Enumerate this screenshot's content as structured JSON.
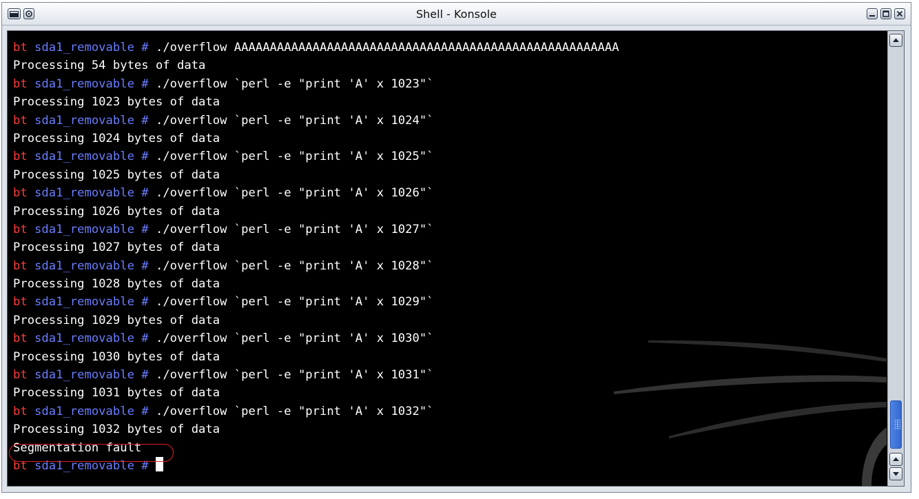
{
  "window": {
    "title": "Shell - Konsole"
  },
  "terminal": {
    "prompt": {
      "user": "bt",
      "dir": "sda1_removable",
      "symbol": "#"
    },
    "lines": [
      {
        "type": "cmd",
        "text": "./overflow AAAAAAAAAAAAAAAAAAAAAAAAAAAAAAAAAAAAAAAAAAAAAAAAAAAAAA"
      },
      {
        "type": "out",
        "text": "Processing 54 bytes of data"
      },
      {
        "type": "cmd",
        "text": "./overflow `perl -e \"print 'A' x 1023\"`"
      },
      {
        "type": "out",
        "text": "Processing 1023 bytes of data"
      },
      {
        "type": "cmd",
        "text": "./overflow `perl -e \"print 'A' x 1024\"`"
      },
      {
        "type": "out",
        "text": "Processing 1024 bytes of data"
      },
      {
        "type": "cmd",
        "text": "./overflow `perl -e \"print 'A' x 1025\"`"
      },
      {
        "type": "out",
        "text": "Processing 1025 bytes of data"
      },
      {
        "type": "cmd",
        "text": "./overflow `perl -e \"print 'A' x 1026\"`"
      },
      {
        "type": "out",
        "text": "Processing 1026 bytes of data"
      },
      {
        "type": "cmd",
        "text": "./overflow `perl -e \"print 'A' x 1027\"`"
      },
      {
        "type": "out",
        "text": "Processing 1027 bytes of data"
      },
      {
        "type": "cmd",
        "text": "./overflow `perl -e \"print 'A' x 1028\"`"
      },
      {
        "type": "out",
        "text": "Processing 1028 bytes of data"
      },
      {
        "type": "cmd",
        "text": "./overflow `perl -e \"print 'A' x 1029\"`"
      },
      {
        "type": "out",
        "text": "Processing 1029 bytes of data"
      },
      {
        "type": "cmd",
        "text": "./overflow `perl -e \"print 'A' x 1030\"`"
      },
      {
        "type": "out",
        "text": "Processing 1030 bytes of data"
      },
      {
        "type": "cmd",
        "text": "./overflow `perl -e \"print 'A' x 1031\"`"
      },
      {
        "type": "out",
        "text": "Processing 1031 bytes of data"
      },
      {
        "type": "cmd",
        "text": "./overflow `perl -e \"print 'A' x 1032\"`"
      },
      {
        "type": "out",
        "text": "Processing 1032 bytes of data"
      },
      {
        "type": "out",
        "text": "Segmentation fault"
      },
      {
        "type": "cmd",
        "text": ""
      }
    ],
    "highlighted_output": "Segmentation fault"
  },
  "colors": {
    "background": "#000000",
    "prompt_user": "#ff3b3b",
    "prompt_dir": "#6a7dff",
    "text": "#ffffff",
    "highlight_ring": "#e02020",
    "scrollbar_thumb": "#3567cc"
  },
  "icons": [
    "window-menu-icon",
    "sticky-icon",
    "minimize-icon",
    "maximize-icon",
    "close-icon",
    "scroll-up-icon",
    "scroll-down-icon"
  ]
}
